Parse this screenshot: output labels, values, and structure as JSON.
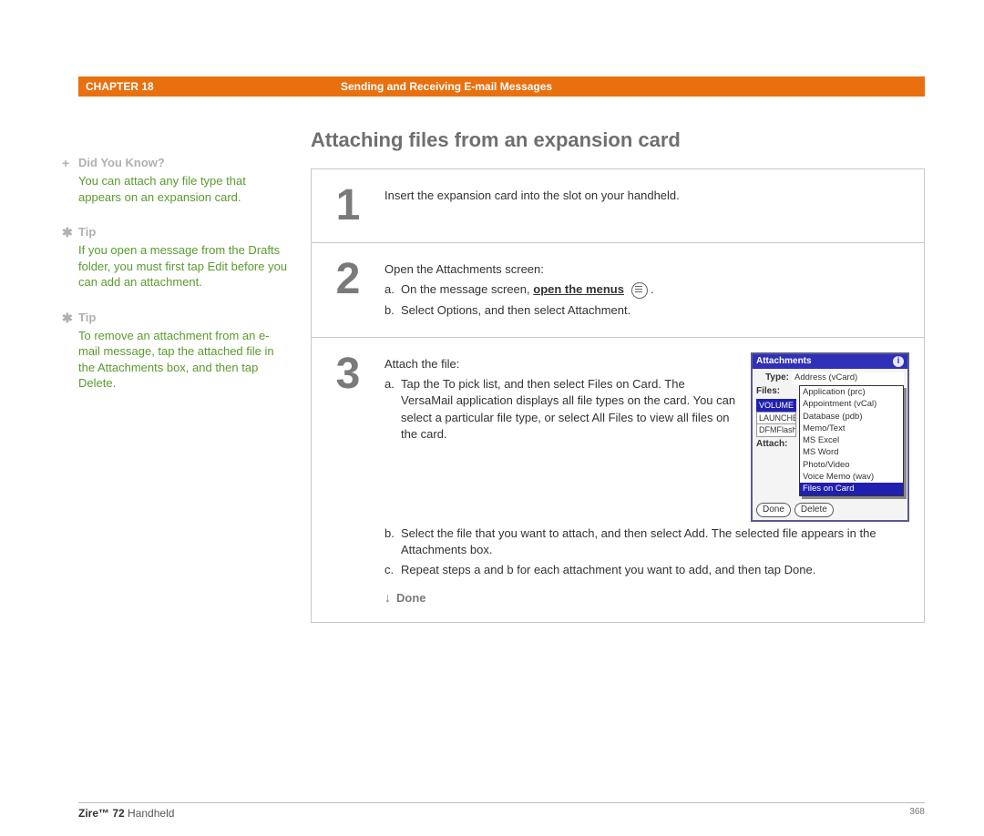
{
  "header": {
    "chapter": "CHAPTER 18",
    "title": "Sending and Receiving E-mail Messages"
  },
  "section": {
    "title": "Attaching files from an expansion card"
  },
  "sidebar": {
    "blocks": [
      {
        "head": "Did You Know?",
        "icon": "+",
        "body": "You can attach any file type that appears on an expansion card."
      },
      {
        "head": "Tip",
        "icon": "✱",
        "body": "If you open a message from the Drafts folder, you must first tap Edit before you can add an attachment."
      },
      {
        "head": "Tip",
        "icon": "✱",
        "body": "To remove an attachment from an e-mail message, tap the attached file in the Attachments box, and then tap Delete."
      }
    ]
  },
  "steps": {
    "1": {
      "num": "1",
      "text": "Insert the expansion card into the slot on your handheld."
    },
    "2": {
      "num": "2",
      "intro": "Open the Attachments screen:",
      "a_pre": "On the message screen, ",
      "a_bold": "open the menus",
      "b": "Select Options, and then select Attachment."
    },
    "3": {
      "num": "3",
      "intro": "Attach the file:",
      "a": "Tap the To pick list, and then select Files on Card. The VersaMail application displays all file types on the card. You can select a particular file type, or select All Files to view all files on the card.",
      "b": "Select the file that you want to attach, and then select Add. The selected file appears in the Attachments box.",
      "c": "Repeat steps a and b for each attachment you want to add, and then tap Done.",
      "done": "Done"
    }
  },
  "mini": {
    "title": "Attachments",
    "type_label": "Type:",
    "files_label": "Files:",
    "left": [
      "VOLUME",
      "LAUNCHE",
      "DFMFlash"
    ],
    "dropdown": [
      "Address (vCard)",
      "Application (prc)",
      "Appointment (vCal)",
      "Database (pdb)",
      "Memo/Text",
      "MS Excel",
      "MS Word",
      "Photo/Video",
      "Voice Memo (wav)",
      "Files on Card"
    ],
    "attach_label": "Attach:",
    "done": "Done",
    "delete": "Delete"
  },
  "footer": {
    "product_bold": "Zire™ 72",
    "product_rest": " Handheld",
    "page": "368"
  }
}
